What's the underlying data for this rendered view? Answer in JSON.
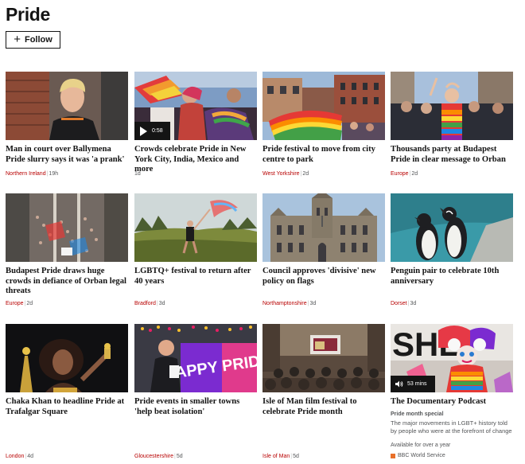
{
  "page": {
    "title": "Pride",
    "follow_label": "Follow"
  },
  "cards": [
    {
      "headline": "Man in court over Ballymena Pride slurry says it was 'a prank'",
      "topic": "Northern Ireland",
      "time": "19h"
    },
    {
      "headline": "Crowds celebrate Pride in New York City, India, Mexico and more",
      "topic": "",
      "time": "1d",
      "video_duration": "0:58"
    },
    {
      "headline": "Pride festival to move from city centre to park",
      "topic": "West Yorkshire",
      "time": "2d"
    },
    {
      "headline": "Thousands party at Budapest Pride in clear message to Orban",
      "topic": "Europe",
      "time": "2d"
    },
    {
      "headline": "Budapest Pride draws huge crowds in defiance of Orban legal threats",
      "topic": "Europe",
      "time": "2d"
    },
    {
      "headline": "LGBTQ+ festival to return after 40 years",
      "topic": "Bradford",
      "time": "3d"
    },
    {
      "headline": "Council approves 'divisive' new policy on flags",
      "topic": "Northamptonshire",
      "time": "3d"
    },
    {
      "headline": "Penguin pair to celebrate 10th anniversary",
      "topic": "Dorset",
      "time": "3d"
    },
    {
      "headline": "Chaka Khan to headline Pride at Trafalgar Square",
      "topic": "London",
      "time": "4d"
    },
    {
      "headline": "Pride events in smaller towns 'help beat isolation'",
      "topic": "Gloucestershire",
      "time": "5d"
    },
    {
      "headline": "Isle of Man film festival to celebrate Pride month",
      "topic": "Isle of Man",
      "time": "5d"
    },
    {
      "headline": "The Documentary Podcast",
      "subtitle": "Pride month special",
      "description": "The major movements in LGBT+ history told by people who were at the forefront of change",
      "availability": "Available for over a year",
      "network": "BBC World Service",
      "audio_duration": "53 mins"
    }
  ],
  "images": {
    "happy_pride_sign": "HAPPY PRIDE!",
    "documentary_art": "SHE"
  },
  "icons": {
    "follow": "plus-icon",
    "video": "play-icon",
    "audio": "speaker-icon",
    "network": "bbc-world-service-logo"
  },
  "colors": {
    "topic_link": "#b80000",
    "meta_text": "#545658",
    "text": "#141414"
  }
}
